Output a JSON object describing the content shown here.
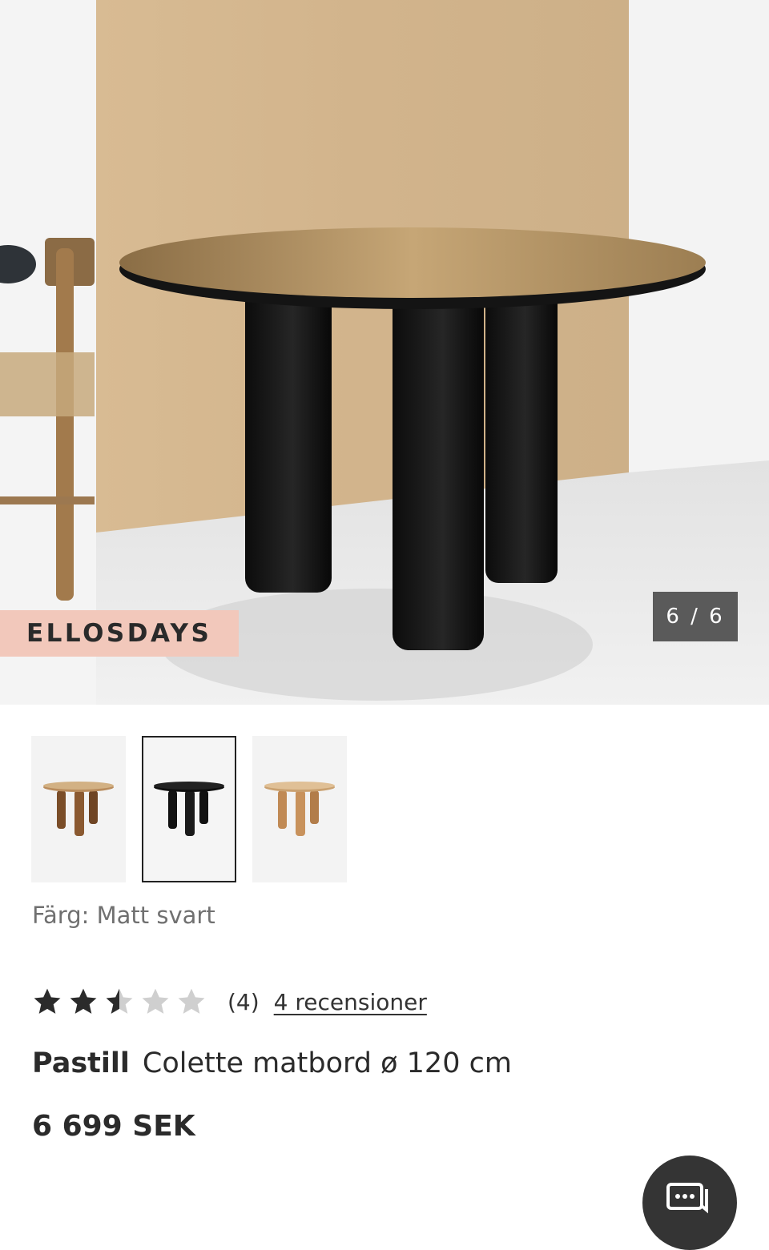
{
  "gallery": {
    "promo_badge": "ELLOSDAYS",
    "counter": "6 / 6",
    "thumbnails": [
      {
        "alt": "Colette matbord ek",
        "finish": "oak"
      },
      {
        "alt": "Colette matbord matt svart",
        "finish": "black",
        "selected": true
      },
      {
        "alt": "Colette matbord natur",
        "finish": "natural"
      }
    ]
  },
  "product": {
    "color_label": "Färg: Matt svart",
    "rating": 2.5,
    "rating_max": 5,
    "review_count": "(4)",
    "reviews_link": "4 recensioner",
    "brand": "Pastill",
    "name": "Colette matbord ø 120 cm",
    "price": "6 699 SEK"
  },
  "icons": {
    "chat": "chat-icon",
    "star": "star-icon"
  },
  "colors": {
    "promo_bg": "#f2c8bb",
    "counter_bg": "#5a5a5a",
    "star_filled": "#2b2b2b",
    "star_empty": "#cfcfcf",
    "chat_bg": "#343434"
  }
}
